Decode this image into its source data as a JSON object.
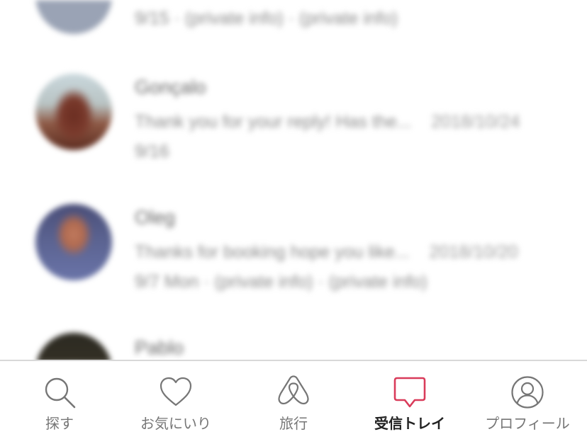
{
  "threads": [
    {
      "line1": "",
      "line2": "9/15 · (private info) · (private info)"
    },
    {
      "name": "Gonçalo",
      "preview": "Thank you for your reply! Has the...",
      "date": "2018/10/24",
      "line2": "9/16"
    },
    {
      "name": "Oleg",
      "preview": "Thanks for booking hope you like...",
      "date": "2018/10/20",
      "line2": "9/7 Mon · (private info) · (private info)"
    },
    {
      "name": "Pablo"
    }
  ],
  "tabbar": {
    "accent_color": "#d93b5a",
    "tabs": [
      {
        "label": "探す",
        "icon": "search-icon",
        "active": false
      },
      {
        "label": "お気にいり",
        "icon": "heart-icon",
        "active": false
      },
      {
        "label": "旅行",
        "icon": "airbnb-logo-icon",
        "active": false
      },
      {
        "label": "受信トレイ",
        "icon": "message-bubble-icon",
        "active": true
      },
      {
        "label": "プロフィール",
        "icon": "profile-icon",
        "active": false
      }
    ]
  }
}
